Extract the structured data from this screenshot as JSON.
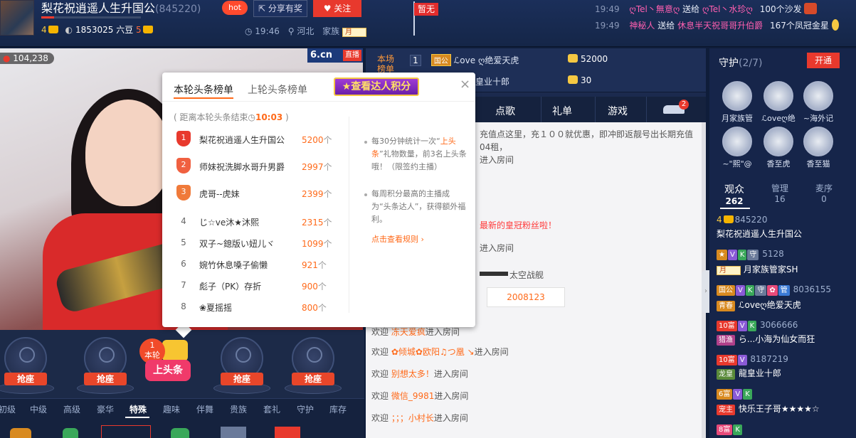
{
  "header": {
    "anchor_name": "梨花祝逍遥人生升国公",
    "anchor_id": "(845220)",
    "level_left": "4",
    "beans": "1853025 六豆",
    "level_right": "5",
    "hot_label": "hot",
    "share_label": "分享有奖",
    "follow_label": "关注",
    "time": "19:46",
    "location": "河北",
    "family_label": "家族",
    "family_badge": "月",
    "flag_label": "暂无"
  },
  "notices": [
    {
      "time": "19:49",
      "from": "ღTel丶無意ღ",
      "action": "送给",
      "to": "ღTel丶水珍ღ",
      "item": "100个沙发"
    },
    {
      "time": "19:49",
      "from": "神秘人",
      "action": "送给",
      "to": "休息半天祝哥哥升伯爵",
      "item": "167个凤冠金星"
    }
  ],
  "video": {
    "viewers": "104,238",
    "logo": "6.cn",
    "live_label": "直播"
  },
  "seats": {
    "grab_label": "抢座",
    "headline_round": "1",
    "headline_round_label": "本轮",
    "headline_label": "上头条"
  },
  "gift_tabs": [
    "初级",
    "中级",
    "高级",
    "豪华",
    "特殊",
    "趣味",
    "伴舞",
    "贵族",
    "套礼",
    "守护",
    "库存"
  ],
  "gift_tab_active": "特殊",
  "popup": {
    "tab_current": "本轮头条榜单",
    "tab_previous": "上轮头条榜单",
    "talent_button": "查看达人积分",
    "countdown_prefix": "( 距离本轮头条结束",
    "countdown_time": "10:03",
    "countdown_suffix": ")",
    "unit": "个",
    "ranks": [
      {
        "n": "1",
        "name": "梨花祝逍遥人生升国公",
        "score": "5200"
      },
      {
        "n": "2",
        "name": "师妹祝洗脚水哥升男爵",
        "score": "2997"
      },
      {
        "n": "3",
        "name": "虎哥--虎妹",
        "score": "2399"
      },
      {
        "n": "4",
        "name": "じ☆ve沐★沐熙",
        "score": "2315"
      },
      {
        "n": "5",
        "name": "双子~鎴版い妞儿ヾ",
        "score": "1099"
      },
      {
        "n": "6",
        "name": "婉竹休息嗓子偷懒",
        "score": "921"
      },
      {
        "n": "7",
        "name": "彪子（PK）存折",
        "score": "900"
      },
      {
        "n": "8",
        "name": "❀夏摇摇",
        "score": "800"
      }
    ],
    "tip1_a": "每30分钟统计一次“",
    "tip1_b": "上头条",
    "tip1_c": "”礼物数量，前3名上头条哦！（限签约主播）",
    "tip2": "每周积分最高的主播成为“头条达人”，获得额外福利。",
    "rules_link": "点击查看规则 ›"
  },
  "rank_board": {
    "label": "本场榜单",
    "rows": [
      {
        "pos": "1",
        "badge": "国公",
        "name": "ℒove ღ绝爱天虎",
        "value": "52000"
      },
      {
        "pos": "",
        "badge": "",
        "name": "皇业十郎",
        "value": "30"
      }
    ]
  },
  "mid_tabs": [
    "点歌",
    "礼单",
    "游戏"
  ],
  "car_badge": "2",
  "chat": {
    "recharge": "充值点这里，充１００就优惠，即冲即返靓号出长期充值",
    "recharge2": "04租，",
    "enter_room": "进入房间",
    "crown_fan": "最新的皇冠粉丝啦！",
    "ship": "太空战舰",
    "ship_count": "2008123",
    "welcome": "欢迎",
    "w1": "冻天爱疯",
    "w2": "✿倾城✿欧阳♫つ凰 ↘",
    "w3": "别想太多！",
    "w4": "微信_9981",
    "w5": "；；；小村长"
  },
  "guard": {
    "title": "守护",
    "count": "(2/7)",
    "open_label": "开通",
    "members": [
      "月家族管",
      "ℒoveღ绝",
      "~海外记",
      "~\"熙\"@",
      "香至虎",
      "香至猫"
    ]
  },
  "audience_tabs": [
    {
      "label": "观众",
      "count": "262"
    },
    {
      "label": "管理",
      "count": "16"
    },
    {
      "label": "麦序",
      "count": "0"
    }
  ],
  "audience": [
    {
      "id": "845220",
      "name": "梨花祝逍遥人生升国公"
    },
    {
      "id": "5128",
      "name": "月家族管家SH",
      "tag": "月"
    },
    {
      "id": "8036155",
      "name": "ℒoveღ绝爱天虎",
      "tag": "青春"
    },
    {
      "id": "3066666",
      "name": "ら...小海为仙女而狂",
      "tag": "猎渔"
    },
    {
      "id": "8187219",
      "name": "龍皇业十郎",
      "tag": "龙皇"
    },
    {
      "id": "",
      "name": "快乐王子哥★★★★☆",
      "tag": "宠主"
    },
    {
      "id": "",
      "name": "",
      "tag": ""
    }
  ],
  "level_badges": {
    "b1": "10富",
    "b2": "10富",
    "b3": "6富",
    "b4": "8富",
    "guo": "国公",
    "v": "V",
    "k": "K",
    "shou": "守",
    "guan": "管"
  },
  "colors": {
    "accent": "#ff6a1a",
    "red": "#e8392d",
    "bg": "#0f1d3a",
    "panel": "#1b2a4e"
  }
}
